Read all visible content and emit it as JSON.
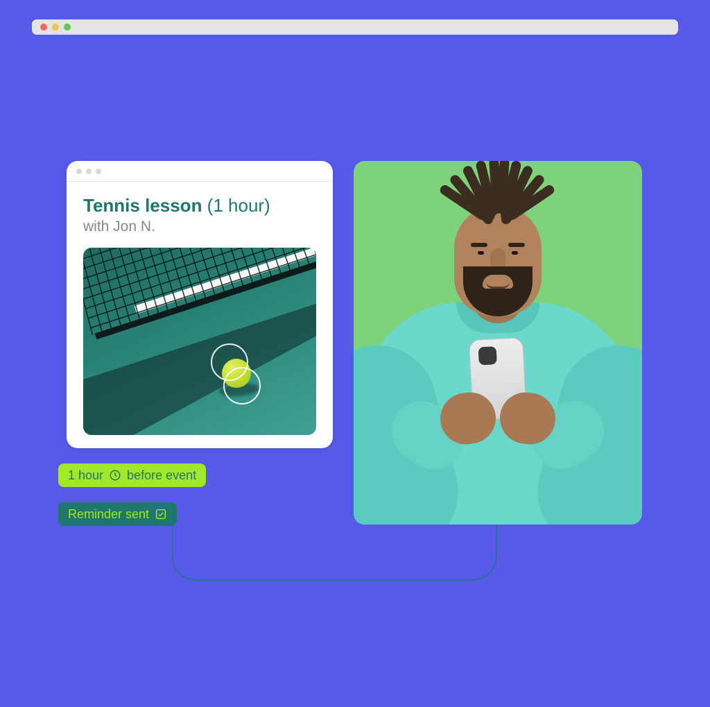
{
  "event": {
    "title_bold": "Tennis lesson",
    "title_rest": " (1 hour)",
    "subtitle": "with Jon N."
  },
  "badges": {
    "reminder_time_prefix": "1 hour",
    "reminder_time_suffix": "before event",
    "reminder_sent": "Reminder sent"
  }
}
